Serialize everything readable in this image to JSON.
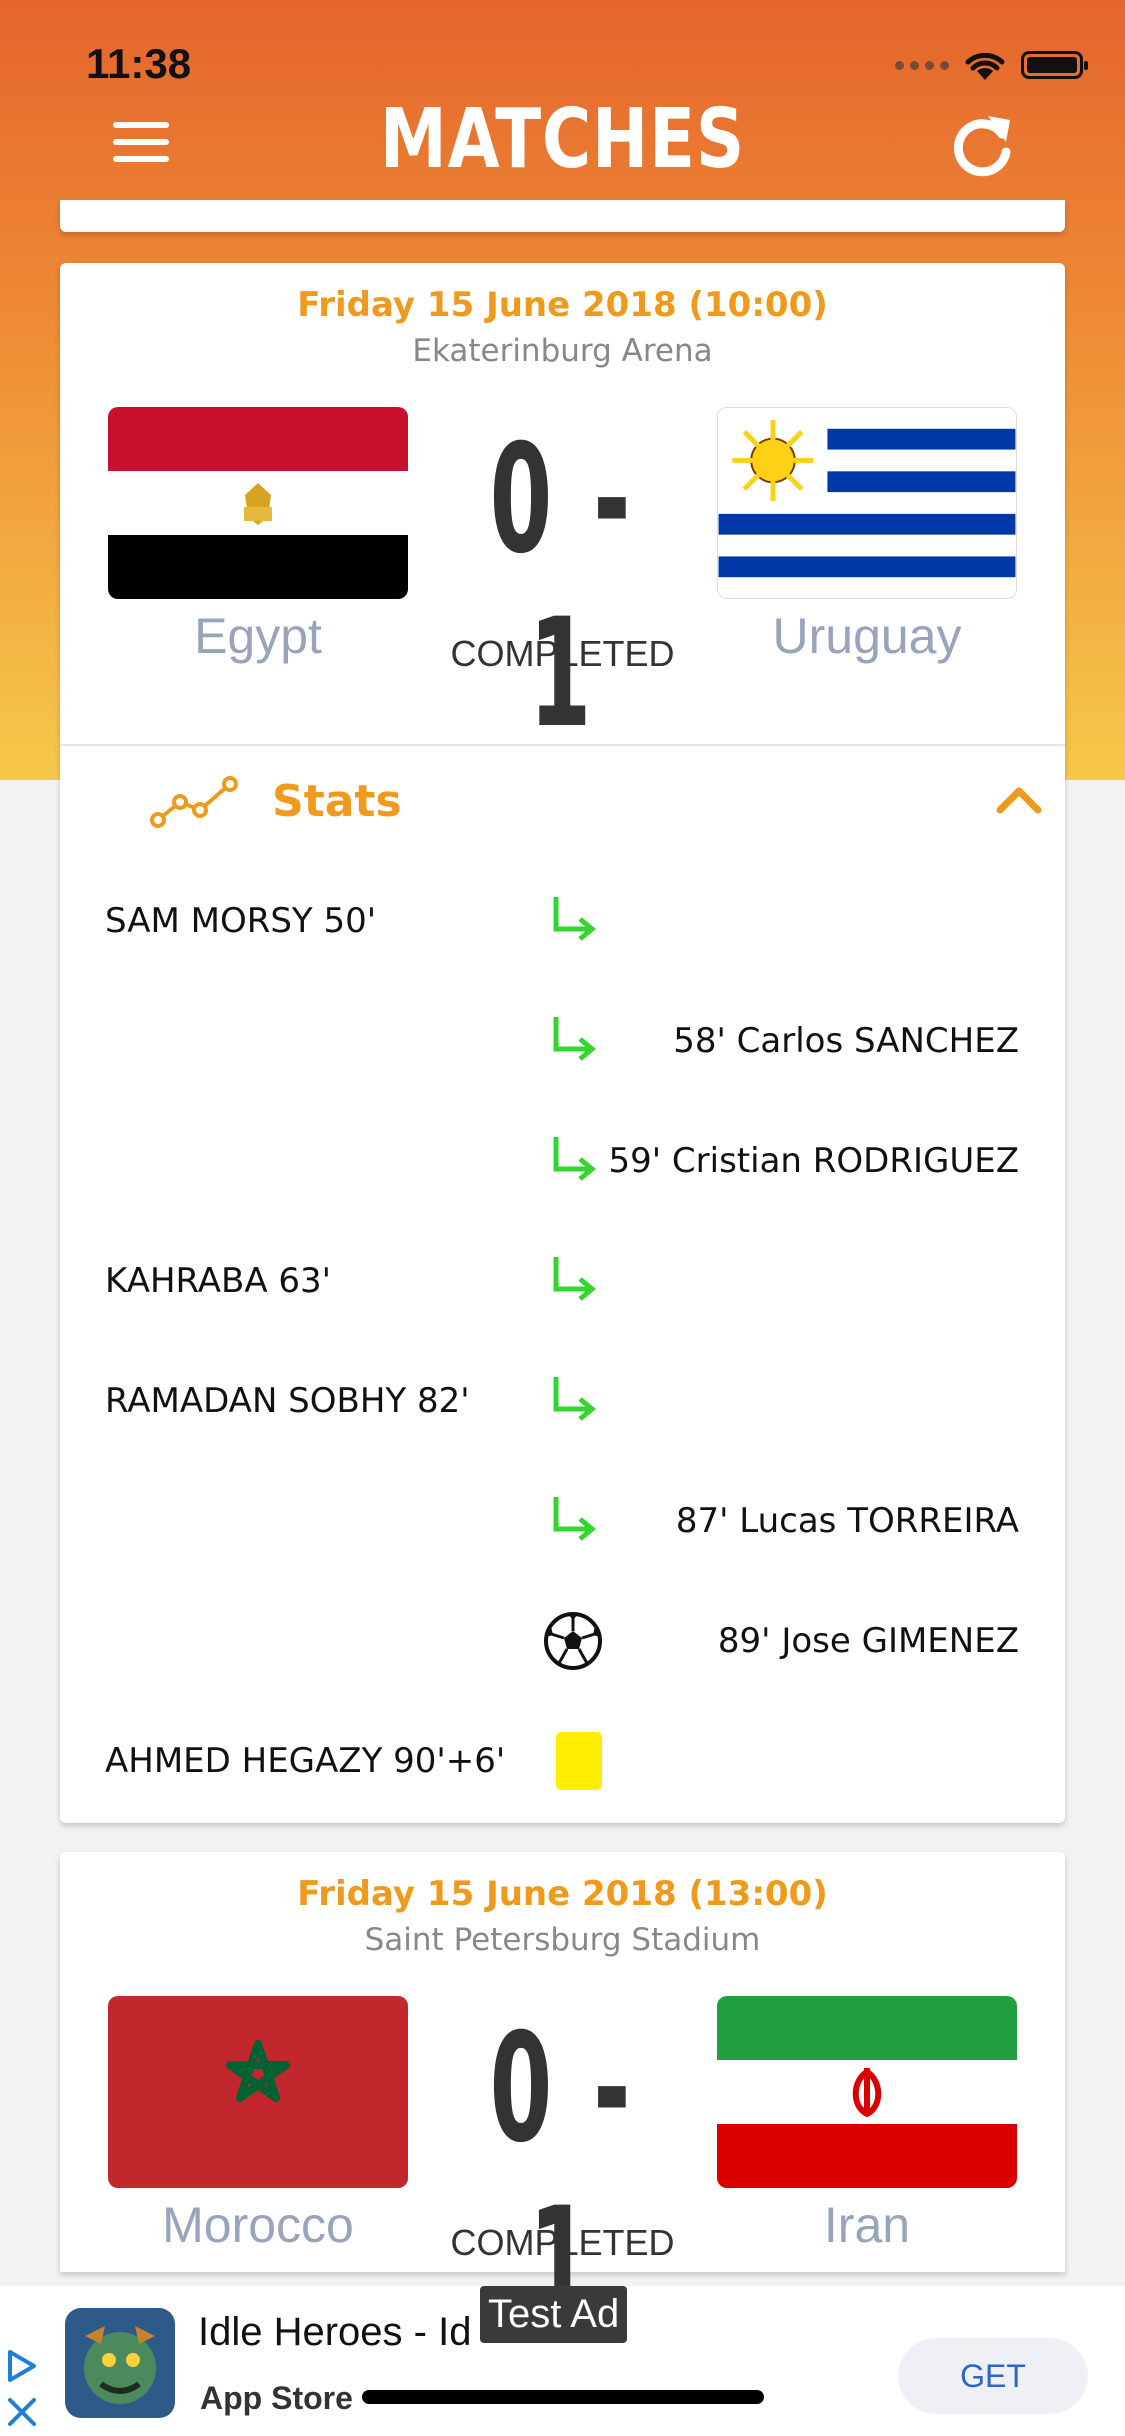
{
  "status_bar": {
    "time": "11:38"
  },
  "header": {
    "title": "MATCHES"
  },
  "matches": [
    {
      "date": "Friday 15 June 2018 (10:00)",
      "venue": "Ekaterinburg Arena",
      "home": "Egypt",
      "away": "Uruguay",
      "score": "0 - 1",
      "status": "COMPLETED",
      "stats_label": "Stats",
      "events": [
        {
          "side": "home",
          "text": "SAM MORSY 50'",
          "icon": "substitution-icon"
        },
        {
          "side": "away",
          "text": "58' Carlos SANCHEZ",
          "icon": "substitution-icon"
        },
        {
          "side": "away",
          "text": "59' Cristian RODRIGUEZ",
          "icon": "substitution-icon"
        },
        {
          "side": "home",
          "text": "KAHRABA 63'",
          "icon": "substitution-icon"
        },
        {
          "side": "home",
          "text": "RAMADAN SOBHY 82'",
          "icon": "substitution-icon"
        },
        {
          "side": "away",
          "text": "87' Lucas TORREIRA",
          "icon": "substitution-icon"
        },
        {
          "side": "away",
          "text": "89' Jose GIMENEZ",
          "icon": "soccer-ball-icon"
        },
        {
          "side": "home",
          "text": "AHMED HEGAZY 90'+6'",
          "icon": "yellow-card-icon"
        }
      ]
    },
    {
      "date": "Friday 15 June 2018 (13:00)",
      "venue": "Saint Petersburg Stadium",
      "home": "Morocco",
      "away": "Iran",
      "score": "0 - 1",
      "status": "COMPLETED"
    }
  ],
  "ad": {
    "title": "Idle Heroes - Id",
    "store": "App Store",
    "cta": "GET",
    "badge": "Test Ad"
  },
  "colors": {
    "accent": "#ef9a1d",
    "header_gradient_top": "#e4652d",
    "header_gradient_bottom": "#f6c84a",
    "team_name": "#97a4bb",
    "substitution": "#33d62e",
    "yellow_card": "#ffee00"
  }
}
